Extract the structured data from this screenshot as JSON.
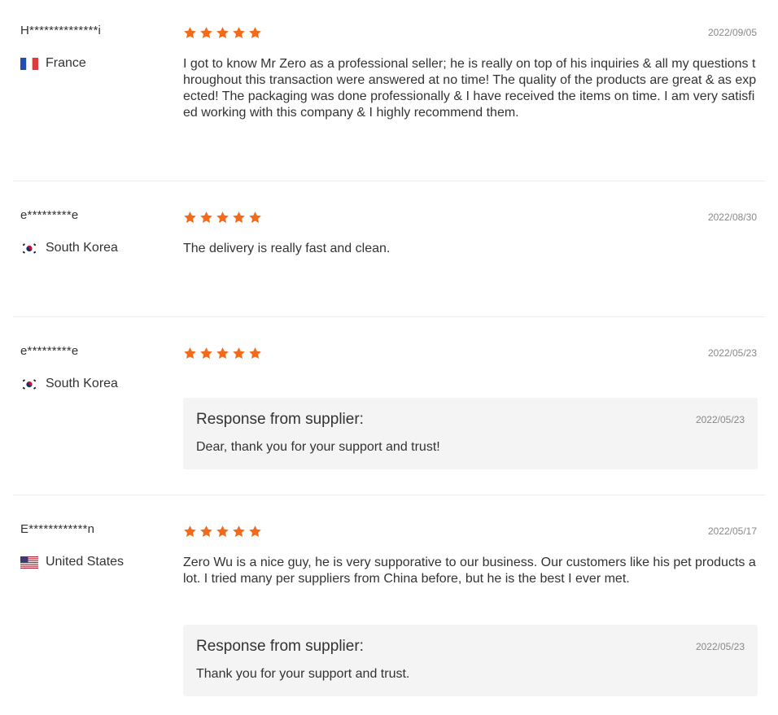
{
  "colors": {
    "star": "#f26b1d",
    "divider": "#ececec",
    "response_bg": "#f4f4f4"
  },
  "reviews": [
    {
      "username": "H**************i",
      "country": "France",
      "flag_icon": "france-flag-icon",
      "rating": 5,
      "date": "2022/09/05",
      "content": "I got to know Mr Zero as a professional seller; he is really on top of his inquiries & all my questions throughout this transaction were answered at no time! The quality of the products are great & as expected! The packaging was done professionally & I have received the items on time. I am very satisfied working with this company & I highly recommend them."
    },
    {
      "username": "e*********e",
      "country": "South Korea",
      "flag_icon": "south-korea-flag-icon",
      "rating": 5,
      "date": "2022/08/30",
      "content": "The delivery is really fast and clean."
    },
    {
      "username": "e*********e",
      "country": "South Korea",
      "flag_icon": "south-korea-flag-icon",
      "rating": 5,
      "date": "2022/05/23",
      "content": "",
      "response": {
        "title": "Response from supplier:",
        "date": "2022/05/23",
        "text": "Dear, thank you for your support and trust!"
      }
    },
    {
      "username": "E************n",
      "country": "United States",
      "flag_icon": "united-states-flag-icon",
      "rating": 5,
      "date": "2022/05/17",
      "content": "Zero Wu is a nice guy, he is very supporative to our business. Our customers like his pet products a lot. I tried many per suppliers from China before, but he is the best I ever met.",
      "response": {
        "title": "Response from supplier:",
        "date": "2022/05/23",
        "text": "Thank you for your support and trust."
      }
    }
  ]
}
